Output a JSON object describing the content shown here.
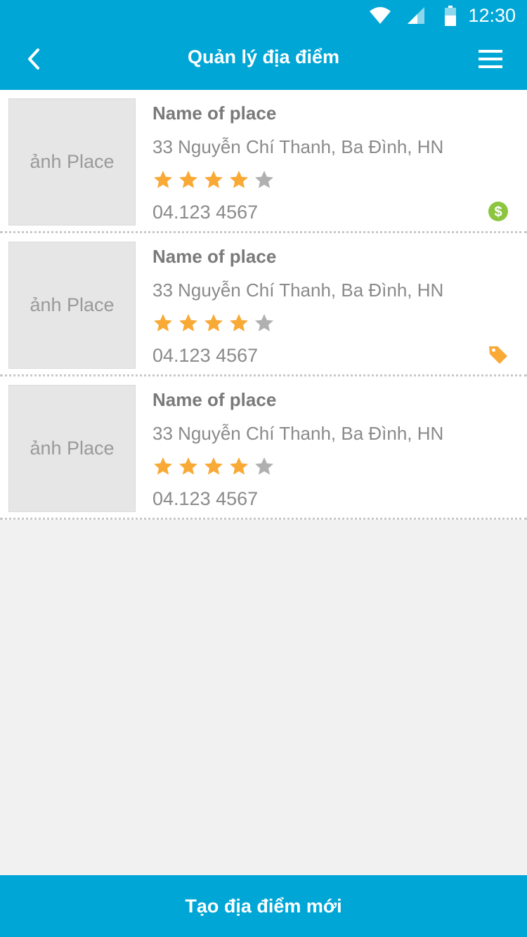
{
  "status_bar": {
    "time": "12:30"
  },
  "header": {
    "title": "Quản lý địa điểm"
  },
  "colors": {
    "accent": "#00a6d6",
    "star_on": "#f9a935",
    "star_off": "#b0b0b0",
    "dollar_badge": "#8cc63f",
    "tag_badge": "#f9a935"
  },
  "places": [
    {
      "thumb_label": "ảnh Place",
      "name": "Name of place",
      "address": "33 Nguyễn Chí Thanh, Ba Đình, HN",
      "rating": 4,
      "max_rating": 5,
      "phone": "04.123 4567",
      "badge": "dollar-icon"
    },
    {
      "thumb_label": "ảnh Place",
      "name": "Name of place",
      "address": "33 Nguyễn Chí Thanh, Ba Đình, HN",
      "rating": 4,
      "max_rating": 5,
      "phone": "04.123 4567",
      "badge": "tag-icon"
    },
    {
      "thumb_label": "ảnh Place",
      "name": "Name of place",
      "address": "33 Nguyễn Chí Thanh, Ba Đình, HN",
      "rating": 4,
      "max_rating": 5,
      "phone": "04.123 4567",
      "badge": ""
    }
  ],
  "footer": {
    "create_label": "Tạo địa điểm mới"
  }
}
